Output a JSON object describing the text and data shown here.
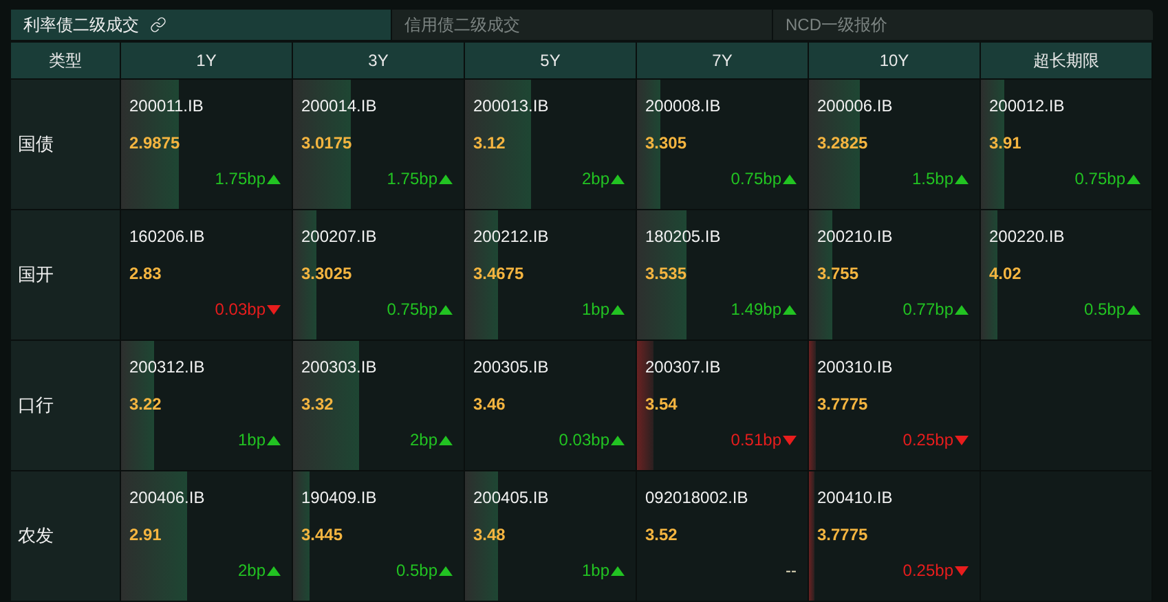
{
  "tabs": [
    {
      "label": "利率债二级成交",
      "selected": true,
      "link_icon": true
    },
    {
      "label": "信用债二级成交",
      "selected": false,
      "link_icon": false
    },
    {
      "label": "NCD一级报价",
      "selected": false,
      "link_icon": false
    }
  ],
  "table": {
    "type_header": "类型",
    "columns": [
      "1Y",
      "3Y",
      "5Y",
      "7Y",
      "10Y",
      "超长期限"
    ],
    "rows": [
      {
        "type": "国债",
        "cells": [
          {
            "code": "200011.IB",
            "price": "2.9875",
            "change": "1.75bp",
            "kind": "up",
            "level": 0.34
          },
          {
            "code": "200014.IB",
            "price": "3.0175",
            "change": "1.75bp",
            "kind": "up",
            "level": 0.34
          },
          {
            "code": "200013.IB",
            "price": "3.12",
            "change": "2bp",
            "kind": "up",
            "level": 0.39
          },
          {
            "code": "200008.IB",
            "price": "3.305",
            "change": "0.75bp",
            "kind": "up",
            "level": 0.14
          },
          {
            "code": "200006.IB",
            "price": "3.2825",
            "change": "1.5bp",
            "kind": "up",
            "level": 0.3
          },
          {
            "code": "200012.IB",
            "price": "3.91",
            "change": "0.75bp",
            "kind": "up",
            "level": 0.14
          }
        ]
      },
      {
        "type": "国开",
        "cells": [
          {
            "code": "160206.IB",
            "price": "2.83",
            "change": "0.03bp",
            "kind": "down"
          },
          {
            "code": "200207.IB",
            "price": "3.3025",
            "change": "0.75bp",
            "kind": "up",
            "level": 0.14
          },
          {
            "code": "200212.IB",
            "price": "3.4675",
            "change": "1bp",
            "kind": "up",
            "level": 0.19
          },
          {
            "code": "180205.IB",
            "price": "3.535",
            "change": "1.49bp",
            "kind": "up",
            "level": 0.29
          },
          {
            "code": "200210.IB",
            "price": "3.755",
            "change": "0.77bp",
            "kind": "up",
            "level": 0.14
          },
          {
            "code": "200220.IB",
            "price": "4.02",
            "change": "0.5bp",
            "kind": "up",
            "level": 0.1
          }
        ]
      },
      {
        "type": "口行",
        "cells": [
          {
            "code": "200312.IB",
            "price": "3.22",
            "change": "1bp",
            "kind": "up",
            "level": 0.19
          },
          {
            "code": "200303.IB",
            "price": "3.32",
            "change": "2bp",
            "kind": "up",
            "level": 0.39
          },
          {
            "code": "200305.IB",
            "price": "3.46",
            "change": "0.03bp",
            "kind": "up"
          },
          {
            "code": "200307.IB",
            "price": "3.54",
            "change": "0.51bp",
            "kind": "down",
            "level": 0.1
          },
          {
            "code": "200310.IB",
            "price": "3.7775",
            "change": "0.25bp",
            "kind": "down",
            "level": 0.04
          }
        ]
      },
      {
        "type": "农发",
        "cells": [
          {
            "code": "200406.IB",
            "price": "2.91",
            "change": "2bp",
            "kind": "up",
            "level": 0.39
          },
          {
            "code": "190409.IB",
            "price": "3.445",
            "change": "0.5bp",
            "kind": "up",
            "level": 0.1
          },
          {
            "code": "200405.IB",
            "price": "3.48",
            "change": "1bp",
            "kind": "up",
            "level": 0.19
          },
          {
            "code": "092018002.IB",
            "price": "3.52",
            "change": "--",
            "kind": "none"
          },
          {
            "code": "200410.IB",
            "price": "3.7775",
            "change": "0.25bp",
            "kind": "down",
            "level": 0.03
          }
        ]
      }
    ]
  }
}
